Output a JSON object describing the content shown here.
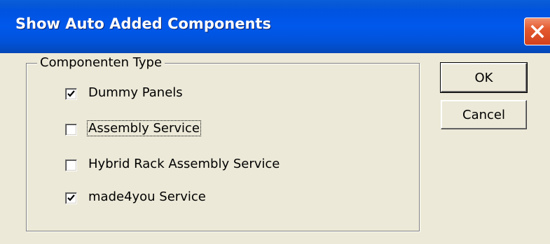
{
  "window": {
    "title": "Show Auto Added Components"
  },
  "group": {
    "legend": "Componenten Type",
    "options": [
      {
        "label": "Dummy Panels",
        "checked": true
      },
      {
        "label": "Assembly Service",
        "checked": false,
        "focused": true
      },
      {
        "label": "Hybrid Rack Assembly Service",
        "checked": false
      },
      {
        "label": "made4you Service",
        "checked": true
      }
    ]
  },
  "buttons": {
    "ok": "OK",
    "cancel": "Cancel"
  }
}
